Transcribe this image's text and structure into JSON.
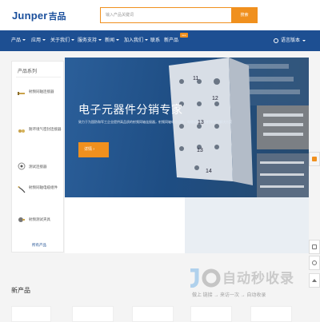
{
  "header": {
    "logo_latin": "Junper",
    "logo_cn": "吉品",
    "search_placeholder": "输入产品关键词",
    "search_button": "搜索"
  },
  "nav": {
    "items": [
      {
        "label": "产品",
        "caret": true
      },
      {
        "label": "应用",
        "caret": true
      },
      {
        "label": "关于我们",
        "caret": true
      },
      {
        "label": "服务支持",
        "caret": true
      },
      {
        "label": "新闻",
        "caret": true
      },
      {
        "label": "加入我们",
        "caret": true
      },
      {
        "label": "联系",
        "caret": false
      },
      {
        "label": "新产品",
        "caret": false
      }
    ],
    "badge": "new",
    "language": "语言版本"
  },
  "sidebar": {
    "title": "产品系列",
    "items": [
      {
        "label": "射频同轴连接器"
      },
      {
        "label": "耐环境气密封连接器"
      },
      {
        "label": "测试连接器"
      },
      {
        "label": "射频同轴电缆组件"
      },
      {
        "label": "射频测试夹具"
      }
    ],
    "more": "所有产品"
  },
  "banner": {
    "title": "电子元器件分销专家",
    "description": "致力于为国防和军工企业提供高品质的射频同轴连接器，射频同轴电缆组件，电缆组件以及射频测试解决方案",
    "button": "详情 ›"
  },
  "section": {
    "new_products": "新产品"
  },
  "watermark": {
    "text": "自动秒收录",
    "sub": "做上 链接 → 来访一次 → 自动收录"
  },
  "colors": {
    "brand_blue": "#1d4f92",
    "accent_orange": "#f0901e"
  }
}
